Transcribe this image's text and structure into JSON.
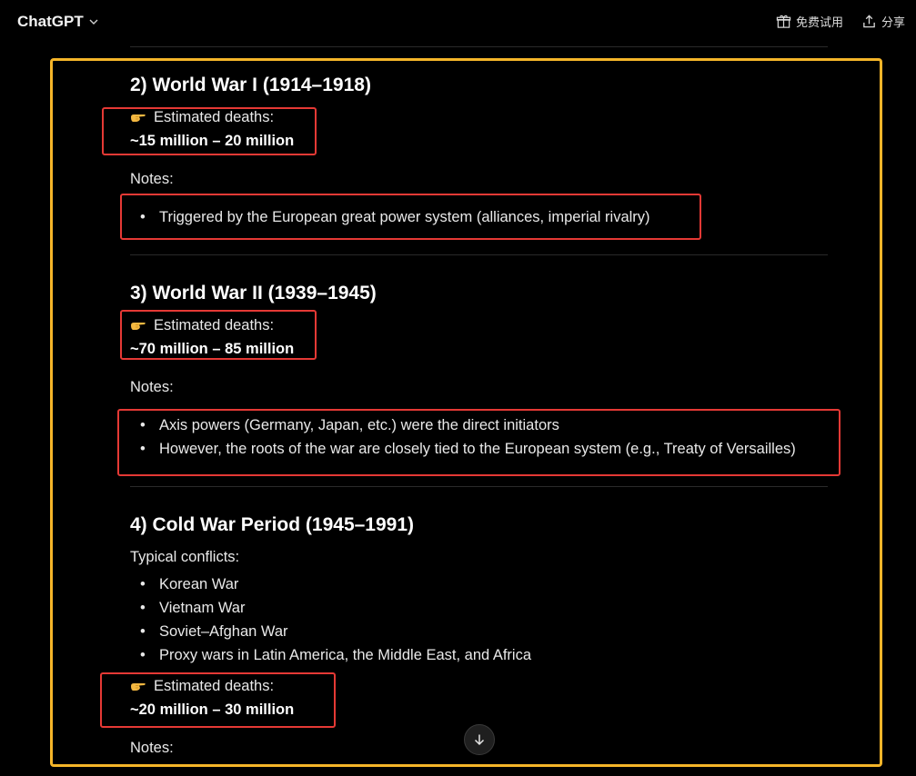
{
  "header": {
    "app_title": "ChatGPT",
    "free_trial": "免费试用",
    "share": "分享"
  },
  "sections": [
    {
      "heading": "2) World War I (1914–1918)",
      "deaths_label": "Estimated deaths:",
      "deaths_value": "~15 million – 20 million",
      "notes_label": "Notes:",
      "notes": [
        "Triggered by the European great power system (alliances, imperial rivalry)"
      ]
    },
    {
      "heading": "3) World War II (1939–1945)",
      "deaths_label": "Estimated deaths:",
      "deaths_value": "~70 million – 85 million",
      "notes_label": "Notes:",
      "notes": [
        "Axis powers (Germany, Japan, etc.) were the direct initiators",
        "However, the roots of the war are closely tied to the European system (e.g., Treaty of Versailles)"
      ]
    },
    {
      "heading": "4) Cold War Period (1945–1991)",
      "conflicts_label": "Typical conflicts:",
      "conflicts": [
        "Korean War",
        "Vietnam War",
        "Soviet–Afghan War",
        "Proxy wars in Latin America, the Middle East, and Africa"
      ],
      "deaths_label": "Estimated deaths:",
      "deaths_value": "~20 million – 30 million",
      "notes_label": "Notes:"
    }
  ],
  "colors": {
    "background": "#000000",
    "highlight_frame": "#f5b529",
    "annotation_box": "#e53935"
  },
  "icons": {
    "pointing_hand": "pointing-hand-icon",
    "chevron": "chevron-down-icon",
    "gift": "gift-icon",
    "share": "share-icon",
    "scroll": "arrow-down-icon"
  }
}
